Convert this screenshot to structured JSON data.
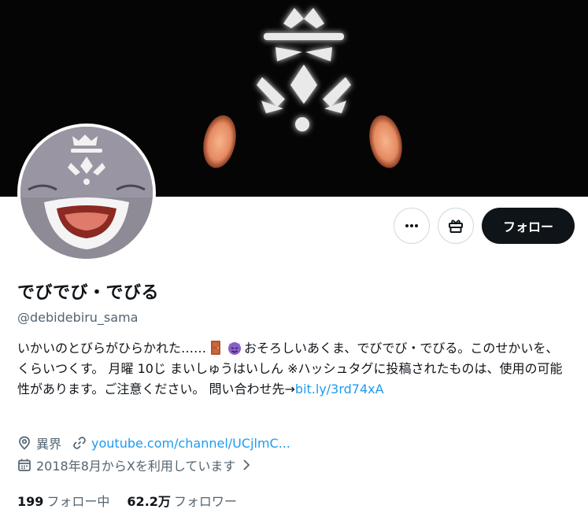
{
  "profile": {
    "display_name": "でびでび・でびる",
    "handle": "@debidebiru_sama",
    "bio_part1": "いかいのとびらがひらかれた……",
    "bio_part2": "おそろしいあくま、でびでび・でびる。このせかいを、くらいつくす。 月曜 10じ まいしゅうはいしん ※ハッシュタグに投稿されたものは、使用の可能性があります。ご注意ください。 問い合わせ先→",
    "bio_link": "bit.ly/3rd74xA",
    "location": "異界",
    "website": "youtube.com/channel/UCjlmC...",
    "joined": "2018年8月からXを利用しています"
  },
  "stats": {
    "following_count": "199",
    "following_label": "フォロー中",
    "followers_count": "62.2万",
    "followers_label": "フォロワー"
  },
  "actions": {
    "follow_label": "フォロー",
    "more_icon": "more-icon",
    "gift_icon": "gift-icon"
  },
  "icons": {
    "door_emoji": "door-emoji",
    "devil_emoji": "devil-emoji",
    "location": "location-icon",
    "link": "link-icon",
    "calendar": "calendar-icon",
    "chevron": "chevron-right-icon"
  },
  "colors": {
    "link": "#1d9bf0",
    "secondary_text": "#536471",
    "follow_button": "#0f1419"
  }
}
